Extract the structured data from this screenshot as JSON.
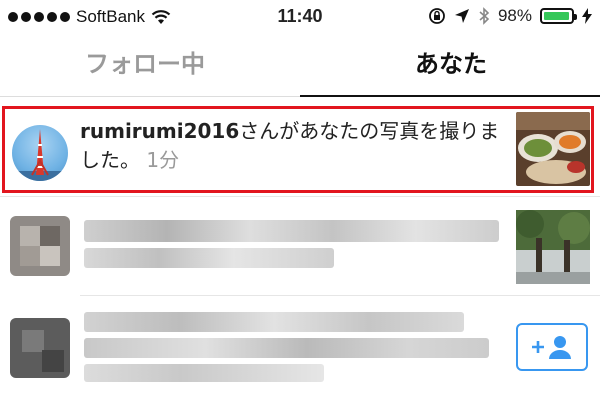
{
  "status_bar": {
    "carrier": "SoftBank",
    "time": "11:40",
    "battery_percent": "98%",
    "battery_level": 0.98,
    "battery_color": "#35c759"
  },
  "tabs": [
    {
      "label": "フォロー中",
      "active": false
    },
    {
      "label": "あなた",
      "active": true
    }
  ],
  "notifications": [
    {
      "username": "rumirumi2016",
      "message": "さんがあなたの写真を撮りました。",
      "time": "1分",
      "highlighted": true,
      "highlight_color": "#e2151e",
      "icons": {
        "avatar": "tower-avatar-icon",
        "thumbnail": "food-photo-icon"
      }
    }
  ],
  "icons": {
    "wifi": "wifi-icon",
    "lock_rotation": "rotation-lock-icon",
    "location": "location-arrow-icon",
    "bluetooth": "bluetooth-icon",
    "charging": "charging-bolt-icon",
    "follow": "add-person-icon"
  },
  "accent_color": "#3897f0"
}
